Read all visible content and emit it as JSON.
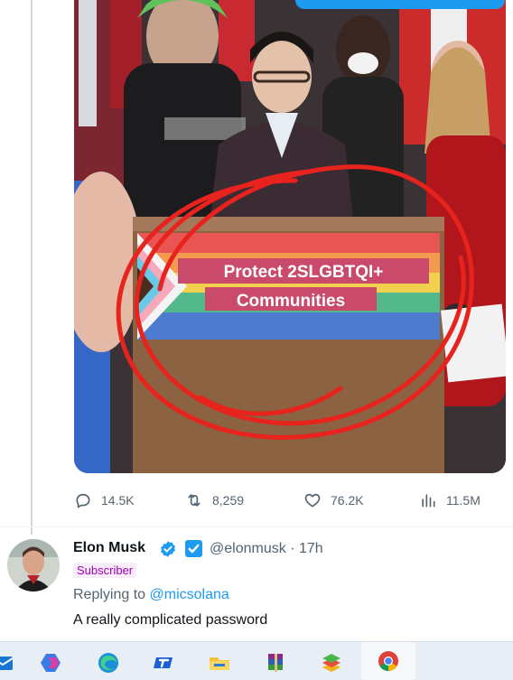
{
  "tweet_media": {
    "podium_sign_line1": "Protect 2SLGBTQI+",
    "podium_sign_line2": "Communities"
  },
  "tweet_actions": {
    "replies": "14.5K",
    "retweets": "8,259",
    "likes": "76.2K",
    "views": "11.5M"
  },
  "reply": {
    "author_name": "Elon Musk",
    "handle": "@elonmusk",
    "separator": "·",
    "time": "17h",
    "badge": "Subscriber",
    "replying_prefix": "Replying to",
    "replying_to": "@micsolana",
    "text": "A really complicated password"
  },
  "colors": {
    "accent": "#1d9bf0",
    "subscriber_text": "#a000b8",
    "annotation_red": "#e8231d"
  },
  "taskbar": {
    "icons": [
      "mail-icon",
      "copilot-icon",
      "edge-icon",
      "tmobile-icon",
      "file-explorer-icon",
      "winrar-icon",
      "bluestacks-icon",
      "chrome-icon"
    ]
  }
}
